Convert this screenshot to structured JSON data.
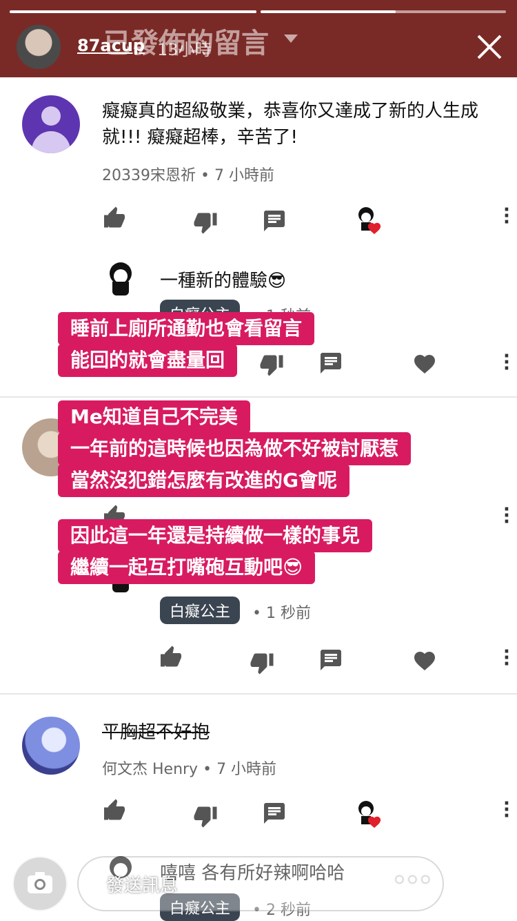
{
  "header": {
    "username": "87acup",
    "time": "13小時",
    "title": "已發佈的留言",
    "progress": [
      1.0,
      0.55
    ]
  },
  "comments": [
    {
      "text": "癡癡真的超級敬業，恭喜你又達成了新的人生成就!!! 癡癡超棒，辛苦了!",
      "author": "20339宋恩祈",
      "time": "7 小時前",
      "avatar_color": "#5e35b1",
      "reply": {
        "text": "一種新的體驗😎",
        "chip": "白癡公主",
        "time": "1 秒前"
      }
    },
    {
      "text": "",
      "author": "",
      "time": "",
      "reply": {
        "text": "",
        "chip": "白癡公主",
        "time": "1 秒前"
      }
    },
    {
      "text": "平胸超不好抱",
      "author": "何文杰 Henry",
      "time": "7 小時前",
      "reply": {
        "text": "嘻嘻 各有所好辣啊哈哈",
        "chip": "白癡公主",
        "time": "2 秒前"
      }
    }
  ],
  "stickers": {
    "s1": [
      "睡前上廁所通勤也會看留言",
      "能回的就會盡量回"
    ],
    "s2": [
      "Me知道自己不完美",
      "一年前的這時候也因為做不好被討厭惹",
      "當然沒犯錯怎麼有改進的G會呢"
    ],
    "s3": [
      "因此這一年還是持續做一樣的事兒",
      "繼續一起互打嘴砲互動吧😎"
    ]
  },
  "bottom": {
    "message_placeholder": "發送訊息",
    "more": "•••"
  },
  "colors": {
    "header_bg": "#7a2a26",
    "sticker_bg": "#d81b60",
    "owner_chip": "#3b4551",
    "heart": "#e0202a"
  },
  "icons": [
    "thumb-up-icon",
    "thumb-down-icon",
    "reply-icon",
    "heart-icon",
    "more-vert-icon",
    "camera-icon",
    "send-icon",
    "close-icon"
  ]
}
